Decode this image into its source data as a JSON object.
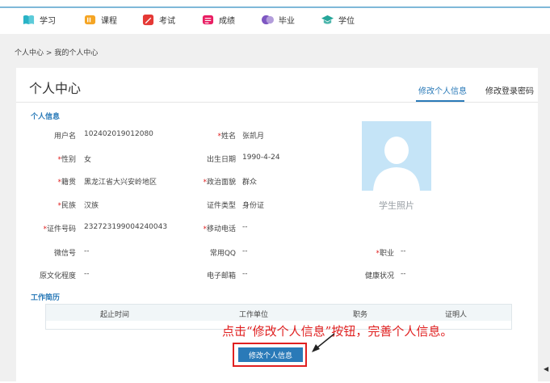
{
  "nav": {
    "items": [
      {
        "label": "学习",
        "icon": "book-icon",
        "color": "#29b3c6"
      },
      {
        "label": "课程",
        "icon": "course-icon",
        "color": "#f5a524"
      },
      {
        "label": "考试",
        "icon": "exam-icon",
        "color": "#e53935"
      },
      {
        "label": "成绩",
        "icon": "grade-icon",
        "color": "#e91e63"
      },
      {
        "label": "毕业",
        "icon": "graduation-icon",
        "color": "#7e57c2"
      },
      {
        "label": "学位",
        "icon": "degree-cap-icon",
        "color": "#26a69a"
      }
    ]
  },
  "breadcrumb": {
    "root": "个人中心",
    "separator": ">",
    "current": "我的个人中心"
  },
  "page": {
    "title": "个人中心",
    "tabs": [
      {
        "label": "修改个人信息",
        "active": true
      },
      {
        "label": "修改登录密码",
        "active": false
      }
    ]
  },
  "personal_info": {
    "section_title": "个人信息",
    "fields": {
      "username": {
        "label": "用户名",
        "required": false,
        "value": "102402019012080"
      },
      "name": {
        "label": "姓名",
        "required": true,
        "value": "张凯月"
      },
      "gender": {
        "label": "性别",
        "required": true,
        "value": "女"
      },
      "birthdate": {
        "label": "出生日期",
        "required": false,
        "value": "1990-4-24"
      },
      "native_place": {
        "label": "籍贯",
        "required": true,
        "value": "黑龙江省大兴安岭地区"
      },
      "political_status": {
        "label": "政治面貌",
        "required": true,
        "value": "群众"
      },
      "ethnicity": {
        "label": "民族",
        "required": true,
        "value": "汉族"
      },
      "id_type": {
        "label": "证件类型",
        "required": false,
        "value": "身份证"
      },
      "id_number": {
        "label": "证件号码",
        "required": true,
        "value": "232723199004240043"
      },
      "mobile": {
        "label": "移动电话",
        "required": true,
        "value": "--"
      },
      "wechat": {
        "label": "微信号",
        "required": false,
        "value": "--"
      },
      "qq": {
        "label": "常用QQ",
        "required": false,
        "value": "--"
      },
      "occupation": {
        "label": "职业",
        "required": true,
        "value": "--"
      },
      "education": {
        "label": "原文化程度",
        "required": false,
        "value": "--"
      },
      "email": {
        "label": "电子邮箱",
        "required": false,
        "value": "--"
      },
      "health": {
        "label": "健康状况",
        "required": false,
        "value": "--"
      }
    },
    "photo_caption": "学生照片",
    "required_mark": "*"
  },
  "work_history": {
    "section_title": "工作简历",
    "columns": [
      "起止时间",
      "工作单位",
      "职务",
      "证明人"
    ]
  },
  "annotation": {
    "text": "点击“修改个人信息”按钮，完善个人信息。",
    "color": "#e02020"
  },
  "edit_button": {
    "label": "修改个人信息"
  },
  "colors": {
    "accent": "#2a7ab8",
    "photo_bg": "#c5e4f7",
    "page_bg": "#f0f0f0"
  }
}
